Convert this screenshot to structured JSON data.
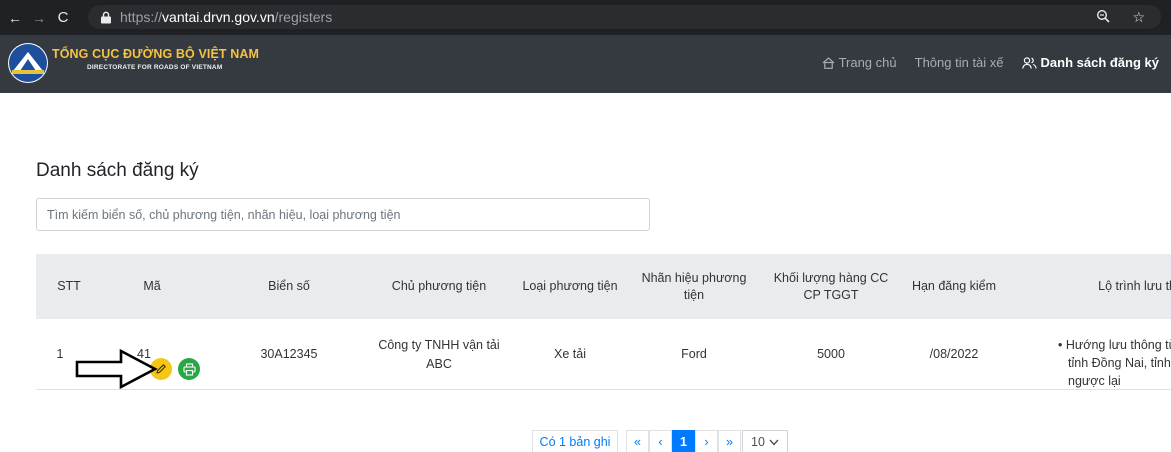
{
  "browser": {
    "url_scheme": "https://",
    "url_host": "vantai.drvn.gov.vn",
    "url_path": "/registers"
  },
  "header": {
    "brand_title": "TỔNG CỤC ĐƯỜNG BỘ VIỆT NAM",
    "brand_subtitle": "DIRECTORATE FOR ROADS OF VIETNAM",
    "nav": [
      {
        "label": "Trang chủ"
      },
      {
        "label": "Thông tin tài xế"
      },
      {
        "label": "Danh sách đăng ký"
      }
    ]
  },
  "page": {
    "title": "Danh sách đăng ký",
    "search_placeholder": "Tìm kiếm biển số, chủ phương tiện, nhãn hiệu, loại phương tiện"
  },
  "table": {
    "columns": [
      {
        "label": "STT"
      },
      {
        "label": "Mã"
      },
      {
        "label": "Biển số"
      },
      {
        "label": "Chủ phương tiện"
      },
      {
        "label": "Loại phương tiện"
      },
      {
        "label": "Nhãn hiệu phương tiện"
      },
      {
        "label": "Khối lượng hàng CC CP TGGT"
      },
      {
        "label": "Hạn đăng kiểm"
      },
      {
        "label": "Lộ trình lưu th"
      }
    ],
    "rows": [
      {
        "stt": "1",
        "ma": "41",
        "bien_so": "30A12345",
        "chu_phuong_tien": "Công ty TNHH vận tải ABC",
        "loai": "Xe tải",
        "nhan_hieu": "Ford",
        "khoi_luong": "5000",
        "han_dang_kiem": "/08/2022",
        "lo_trinh": [
          "Hướng lưu thông từ",
          "tỉnh Đồng Nai, tỉnh",
          "ngược lại"
        ]
      }
    ]
  },
  "pagination": {
    "info": "Có 1 bản ghi",
    "first": "«",
    "prev": "‹",
    "current": "1",
    "next": "›",
    "last": "»",
    "page_size": "10"
  }
}
